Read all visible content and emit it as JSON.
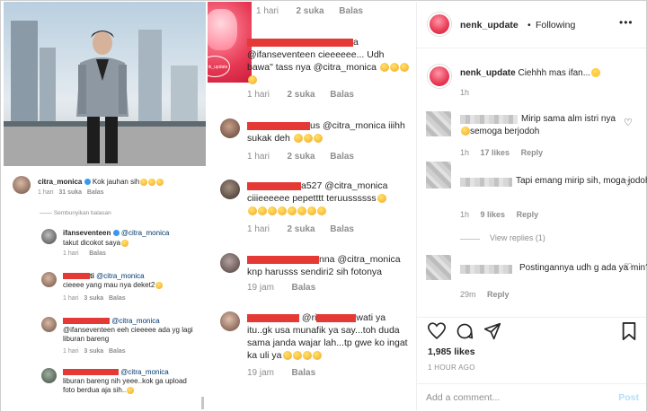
{
  "left_panel": {
    "main_comment": {
      "user": "citra_monica",
      "text": "Kok jauhan sih",
      "time": "1 hari",
      "likes": "31 suka",
      "reply": "Balas"
    },
    "hide_replies": "Sembunyikan balasan",
    "replies": [
      {
        "user": "ifanseventeen",
        "mention": "@citra_monica",
        "text": "takut dicokot saya",
        "time": "1 hari",
        "likes": "",
        "reply": "Balas"
      },
      {
        "user": "ti",
        "mention": "@citra_monica",
        "text": "cieeee yang mau nya deket2",
        "time": "1 hari",
        "likes": "3 suka",
        "reply": "Balas"
      },
      {
        "user": "",
        "mention": "@citra_monica",
        "text": "@ifanseventeen  eeh cieeeee ada yg lagi liburan bareng",
        "time": "1 hari",
        "likes": "3 suka",
        "reply": "Balas"
      },
      {
        "user": "",
        "mention": "@citra_monica",
        "text": "liburan bareng nih yeee..kok ga upload foto berdua aja sih..",
        "time": "1 hari",
        "likes": "",
        "reply": ""
      }
    ]
  },
  "middle_panel": {
    "top_meta": {
      "time": "1 hari",
      "likes": "2 suka",
      "reply": "Balas"
    },
    "comments": [
      {
        "user_suffix": "a",
        "text": "@ifanseventeen cieeeeee... Udh bawa\" tass nya @citra_monica",
        "time": "1 hari",
        "likes": "2 suka",
        "reply": "Balas"
      },
      {
        "user_suffix": "us",
        "text": "@citra_monica iiihh sukak deh",
        "time": "1 hari",
        "likes": "2 suka",
        "reply": "Balas"
      },
      {
        "user_suffix": "a527",
        "text": "@citra_monica ciiieeeeee pepetttt teruussssss",
        "time": "1 hari",
        "likes": "2 suka",
        "reply": "Balas"
      },
      {
        "user_suffix": "nna",
        "text": "@citra_monica knp harusss sendiri2 sih fotonya",
        "time": "19 jam",
        "likes": "",
        "reply": "Balas"
      },
      {
        "user_suffix": "@ri",
        "mention_end": "wati",
        "text_after": "ya itu..gk usa munafik ya say...toh duda sama janda wajar lah...tp gwe ko ingat ka uli ya",
        "time": "19 jam",
        "likes": "",
        "reply": "Balas"
      }
    ],
    "tile_badge": "nenk_update"
  },
  "right_panel": {
    "header": {
      "username": "nenk_update",
      "separator": "•",
      "follow": "Following",
      "more": "•••"
    },
    "caption": {
      "user": "nenk_update",
      "text": "Ciehhh mas ifan...",
      "time": "1h"
    },
    "comments": [
      {
        "text": "Mirip sama alm istri nya",
        "text2": "semoga berjodoh",
        "time": "1h",
        "likes": "17 likes",
        "reply": "Reply"
      },
      {
        "text": "Tapi emang mirip sih, moga jodoh deh",
        "time": "1h",
        "likes": "9 likes",
        "reply": "Reply"
      },
      {
        "text": "Postingannya udh g ada ya min?",
        "time": "29m",
        "likes": "",
        "reply": "Reply"
      }
    ],
    "view_replies": "View replies (1)",
    "likes_count": "1,985 likes",
    "posted_ago": "1 HOUR AGO",
    "add_comment_placeholder": "Add a comment...",
    "post_button": "Post"
  }
}
